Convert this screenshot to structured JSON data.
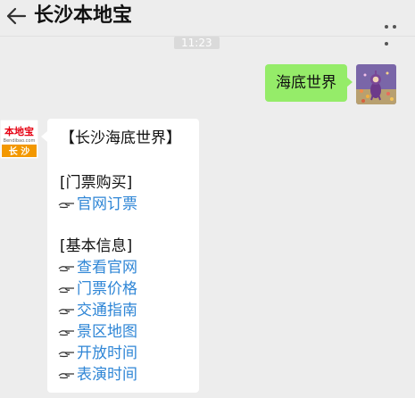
{
  "header": {
    "title": "长沙本地宝"
  },
  "chat": {
    "time": "11:23",
    "user_message": "海底世界",
    "bot_avatar": {
      "brand_text": "本地宝",
      "domain_text": "Bendibao.com",
      "city_text": "长 沙"
    },
    "reply": {
      "title": "【长沙海底世界】",
      "section1": "[门票购买]",
      "section1_links": [
        "官网订票"
      ],
      "section2": "[基本信息]",
      "section2_links": [
        "查看官网",
        "门票价格",
        "交通指南",
        "景区地图",
        "开放时间",
        "表演时间"
      ]
    }
  },
  "colors": {
    "background": "#ededed",
    "user_bubble": "#95ec69",
    "link": "#2f86d6",
    "brand_red": "#e60012",
    "brand_orange": "#f39800"
  },
  "icons": {
    "back": "arrow-left-icon",
    "more": "more-dots-icon",
    "pointer": "pointing-hand-icon"
  }
}
